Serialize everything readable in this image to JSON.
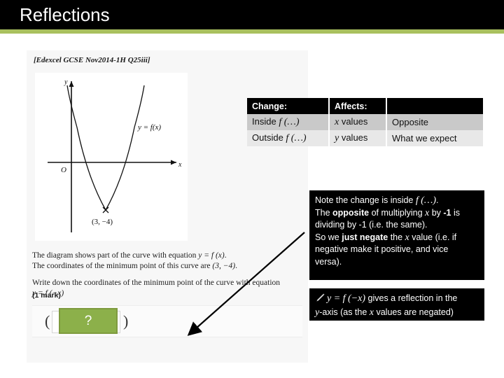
{
  "header": {
    "title": "Reflections",
    "background_color": "#000000",
    "accent_bar_color": "#a9c05e"
  },
  "question": {
    "exam_reference": "[Edexcel GCSE Nov2014-1H Q25iii]",
    "line1_prefix": "The diagram shows part of the curve with equation ",
    "line1_math": "y = f (x)",
    "line1_suffix": ".",
    "line2_prefix": "The coordinates of the minimum point of this curve are ",
    "line2_math": "(3, −4)",
    "line2_suffix": ".",
    "line3": "Write down the coordinates of the minimum point of the curve with equation",
    "line4_math": "y = f (−x)",
    "marks": "(1 mark)",
    "answer": {
      "paren_open": "(",
      "paren_close": ")",
      "reveal_label": "?",
      "reveal_fill_color": "#8cb04a",
      "reveal_border_color": "#7f9b3f"
    }
  },
  "graph": {
    "y_axis_label": "y",
    "x_axis_label": "x",
    "origin_label": "O",
    "curve_label": "y = f(x)",
    "minimum_point_label": "(3, −4)"
  },
  "chart_data": {
    "type": "line",
    "title": "",
    "xlabel": "x",
    "ylabel": "y",
    "curve_equation": "y = f(x)",
    "vertex": [
      3,
      -4
    ],
    "roots": [
      1,
      5
    ],
    "xlim": [
      -1.6,
      7.2
    ],
    "ylim": [
      -6.2,
      10.5
    ],
    "grid": false,
    "annotations": [
      {
        "text": "(3, −4)",
        "x": 3,
        "y": -4
      },
      {
        "text": "y = f(x)",
        "x": 5.3,
        "y": 4.2
      },
      {
        "text": "O",
        "x": -0.35,
        "y": -0.75
      }
    ]
  },
  "summary_table": {
    "headers": [
      "Change:",
      "Affects:",
      ""
    ],
    "rows": [
      {
        "change_prefix": "Inside ",
        "change_math": "f (…)",
        "affects_math": "x",
        "affects_suffix": " values",
        "result": "Opposite"
      },
      {
        "change_prefix": "Outside ",
        "change_math": "f (…)",
        "affects_math": "y",
        "affects_suffix": " values",
        "result": "What we expect"
      }
    ]
  },
  "explanation_box": {
    "l1_a": "Note the change is inside ",
    "l1_math": "f (…)",
    "l1_b": ".",
    "l2_a": "The ",
    "l2_bold1": "opposite",
    "l2_b": " of multiplying ",
    "l2_math": "x",
    "l2_c": " by ",
    "l2_bold2": "-1",
    "l2_d": " is",
    "l3": "dividing by -1 (i.e. the same).",
    "l4_a": "So we ",
    "l4_bold": "just negate",
    "l4_b": " the ",
    "l4_math": "x",
    "l4_c": " value (i.e. if",
    "l5": "negative make it positive, and vice",
    "l6": "versa)."
  },
  "conclusion_box": {
    "icon": "pencil-icon",
    "l1_math": "y = f (−x)",
    "l1_text": " gives a reflection in the",
    "l2_math": "y",
    "l2_text_a": "-axis (as the ",
    "l2_math2": "x",
    "l2_text_b": " values are negated)"
  }
}
